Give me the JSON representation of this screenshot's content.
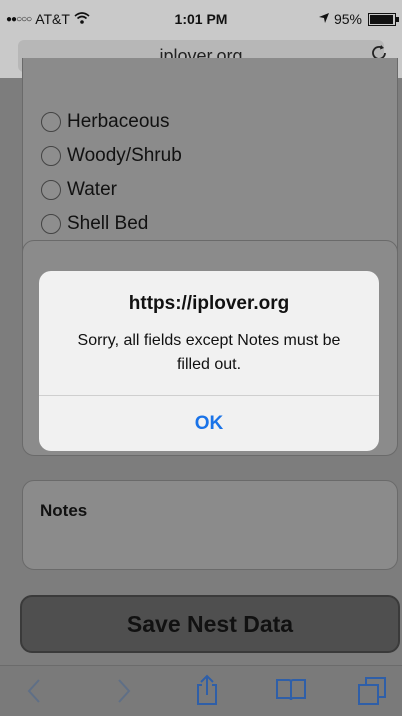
{
  "status_bar": {
    "carrier": "AT&T",
    "time": "1:01 PM",
    "battery": "95%",
    "battery_level": 0.95
  },
  "browser": {
    "url": "iplover.org"
  },
  "form": {
    "habitat_options": [
      "Herbaceous",
      "Woody/Shrub",
      "Water",
      "Shell Bed"
    ],
    "notes_label": "Notes",
    "save_button": "Save Nest Data"
  },
  "alert": {
    "title": "https://iplover.org",
    "message": "Sorry, all fields except Notes must be filled out.",
    "ok_label": "OK"
  },
  "colors": {
    "accent": "#1a73e8",
    "toolbar_icons": "#2f5fa8"
  },
  "icons": [
    "wifi-icon",
    "location-arrow-icon",
    "battery-icon",
    "reload-icon",
    "back-icon",
    "forward-icon",
    "share-icon",
    "bookmarks-icon",
    "tabs-icon"
  ]
}
